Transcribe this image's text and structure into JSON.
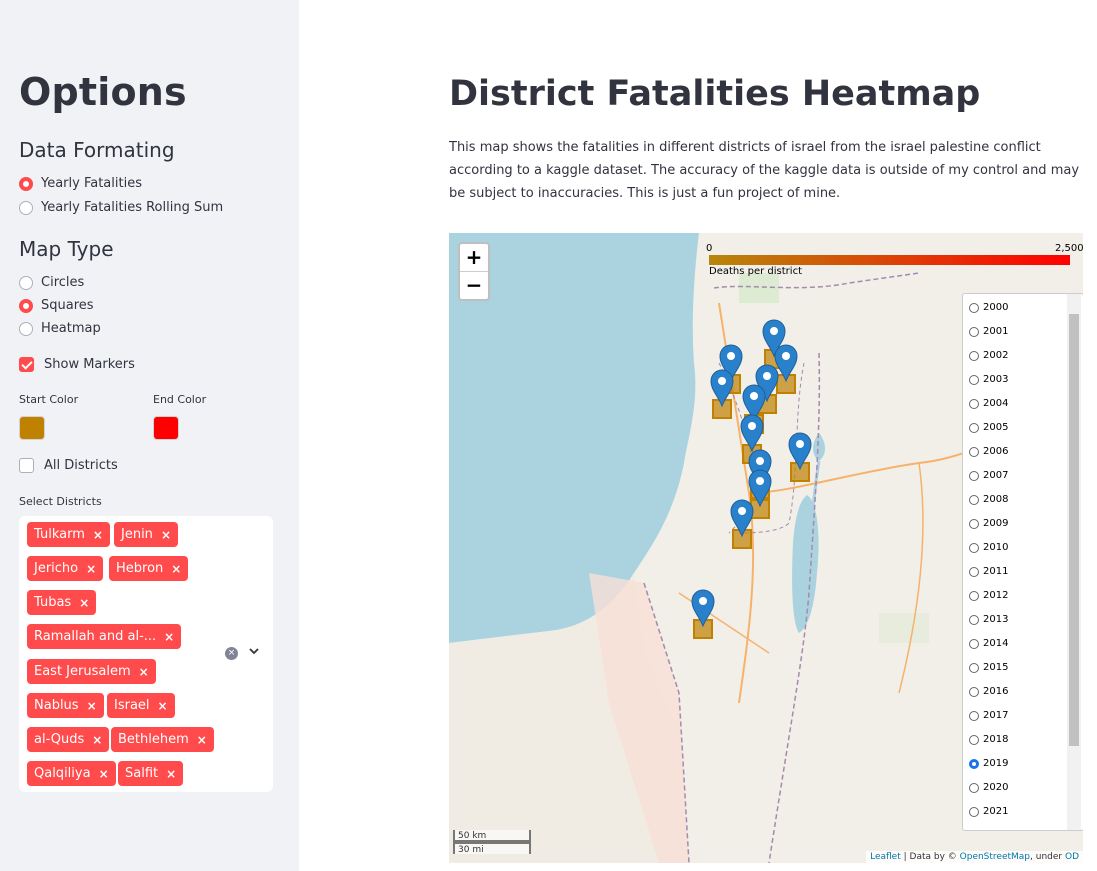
{
  "sidebar": {
    "title": "Options",
    "data_formatting": {
      "heading": "Data Formating",
      "options": [
        {
          "label": "Yearly Fatalities",
          "selected": true
        },
        {
          "label": "Yearly Fatalities Rolling Sum",
          "selected": false
        }
      ]
    },
    "map_type": {
      "heading": "Map Type",
      "options": [
        {
          "label": "Circles",
          "selected": false
        },
        {
          "label": "Squares",
          "selected": true
        },
        {
          "label": "Heatmap",
          "selected": false
        }
      ]
    },
    "show_markers": {
      "label": "Show Markers",
      "checked": true
    },
    "start_color": {
      "label": "Start Color",
      "value": "#c08000"
    },
    "end_color": {
      "label": "End Color",
      "value": "#ff0000"
    },
    "all_districts": {
      "label": "All Districts",
      "checked": false
    },
    "select_districts": {
      "label": "Select Districts",
      "tags": [
        "Tulkarm",
        "Jenin",
        "Jericho",
        "Hebron",
        "Tubas",
        "Ramallah and al-...",
        "East Jerusalem",
        "Nablus",
        "Israel",
        "al-Quds",
        "Bethlehem",
        "Qalqiliya",
        "Salfit"
      ],
      "remove_glyph": "×",
      "clear_glyph": "×"
    }
  },
  "main": {
    "title": "District Fatalities Heatmap",
    "description": "This map shows the fatalities in different districts of israel from the israel palestine conflict according to a kaggle dataset. The accuracy of the kaggle data is outside of my control and may be subject to inaccuracies. This is just a fun project of mine."
  },
  "map": {
    "zoom_in": "+",
    "zoom_out": "−",
    "legend": {
      "min": "0",
      "max": "2,500",
      "caption": "Deaths per district",
      "start_color": "#b8860b",
      "end_color": "#ff0000"
    },
    "years": [
      "2000",
      "2001",
      "2002",
      "2003",
      "2004",
      "2005",
      "2006",
      "2007",
      "2008",
      "2009",
      "2010",
      "2011",
      "2012",
      "2013",
      "2014",
      "2015",
      "2016",
      "2017",
      "2018",
      "2019",
      "2020",
      "2021"
    ],
    "selected_year": "2019",
    "scale_km": "50 km",
    "scale_mi": "30 mi",
    "attribution": {
      "leaflet": "Leaflet",
      "sep": " | Data by © ",
      "osm": "OpenStreetMap",
      "under": ", under ",
      "od": "OD"
    },
    "marker_color": "#2a81cb",
    "square_color": "#c08000"
  }
}
